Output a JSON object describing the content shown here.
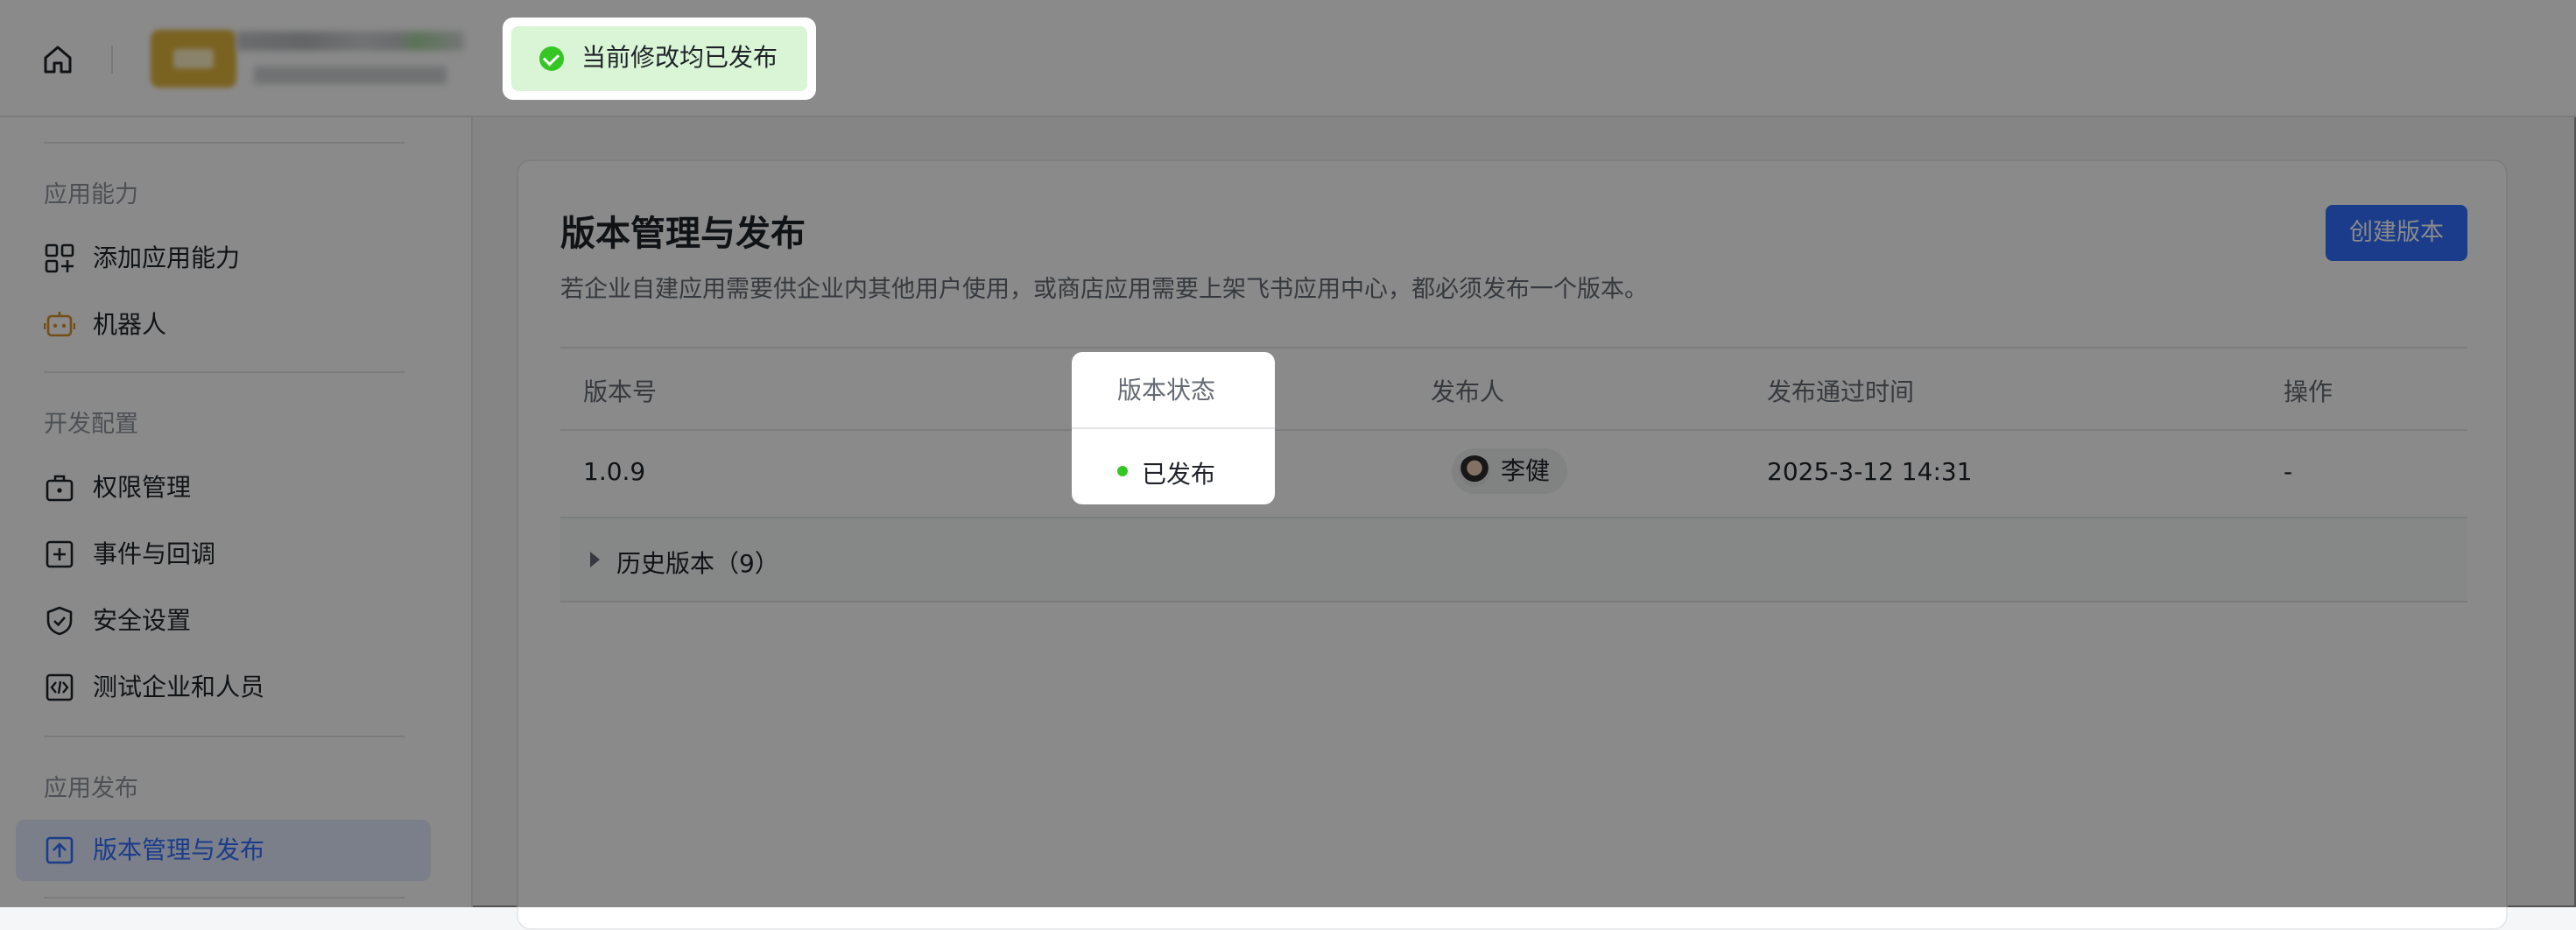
{
  "toast": {
    "message": "当前修改均已发布",
    "icon": "check-circle-icon"
  },
  "header": {
    "home_icon": "home-icon"
  },
  "sidebar": {
    "sections": [
      {
        "title": "应用能力",
        "items": [
          {
            "label": "添加应用能力",
            "icon": "apps-add-icon"
          },
          {
            "label": "机器人",
            "icon": "robot-icon"
          }
        ]
      },
      {
        "title": "开发配置",
        "items": [
          {
            "label": "权限管理",
            "icon": "permission-bag-icon"
          },
          {
            "label": "事件与回调",
            "icon": "event-plus-icon"
          },
          {
            "label": "安全设置",
            "icon": "shield-check-icon"
          },
          {
            "label": "测试企业和人员",
            "icon": "code-box-icon"
          }
        ]
      },
      {
        "title": "应用发布",
        "items": [
          {
            "label": "版本管理与发布",
            "icon": "upload-box-icon",
            "active": true
          }
        ]
      }
    ]
  },
  "main": {
    "title": "版本管理与发布",
    "description": "若企业自建应用需要供企业内其他用户使用，或商店应用需要上架飞书应用中心，都必须发布一个版本。",
    "create_button": "创建版本",
    "table": {
      "headers": [
        "版本号",
        "版本状态",
        "发布人",
        "发布通过时间",
        "操作"
      ],
      "row": {
        "version": "1.0.9",
        "status": "已发布",
        "publisher": "李健",
        "time": "2025-3-12 14:31",
        "action": "-"
      },
      "history_label": "历史版本（9）"
    }
  },
  "colors": {
    "accent": "#3370ff",
    "success": "#34c724",
    "toast_bg": "#d9f5d6"
  }
}
